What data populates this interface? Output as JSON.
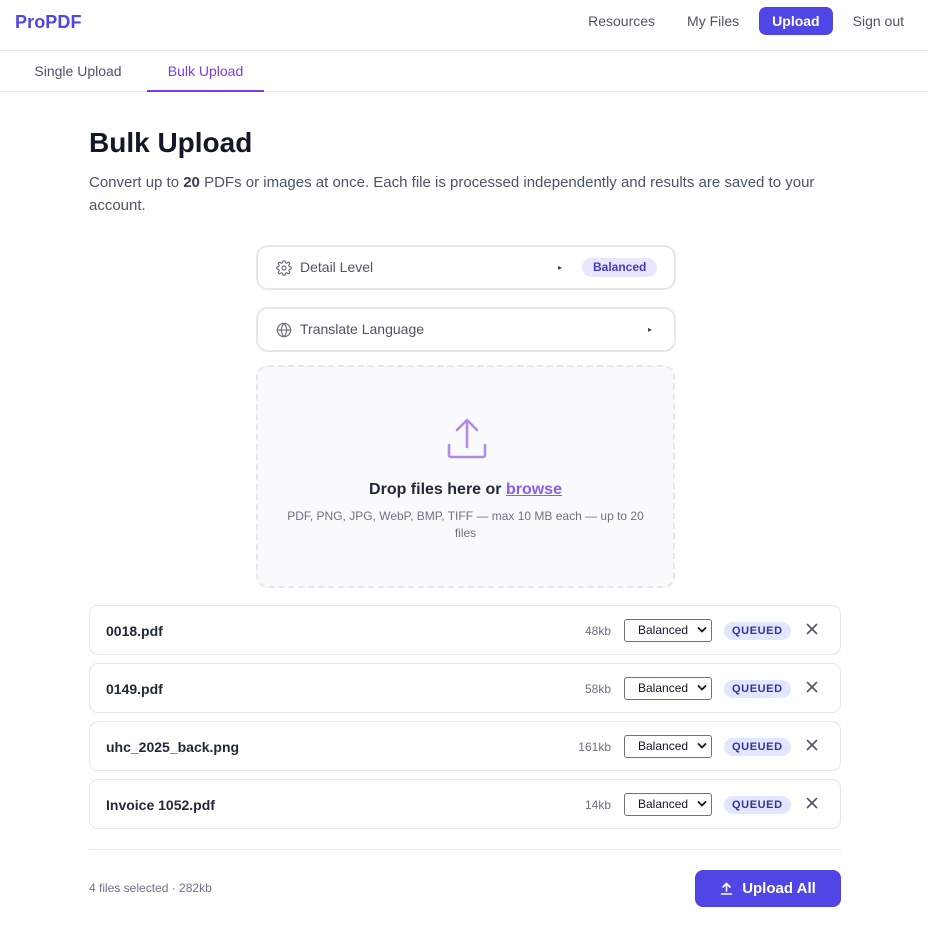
{
  "nav": {
    "brand": "ProPDF",
    "links": [
      {
        "label": "Resources"
      },
      {
        "label": "My Files"
      },
      {
        "label": "Upload"
      },
      {
        "label": "Sign out"
      }
    ]
  },
  "tabs": [
    {
      "label": "Single Upload"
    },
    {
      "label": "Bulk Upload"
    }
  ],
  "header": {
    "title": "Bulk Upload",
    "subtitle_before": "Convert up to ",
    "subtitle_count": "20",
    "subtitle_after": " PDFs or images at once. Each file is processed independently and results are saved to your account."
  },
  "options": {
    "detail_level": {
      "label": "Detail Level",
      "value": "Balanced",
      "icon": "gear-icon",
      "caret": "▸"
    },
    "translate_language": {
      "label": "Translate Language",
      "icon": "globe-icon",
      "caret": "▸"
    }
  },
  "dropzone": {
    "title_prefix": "Drop files here or ",
    "browse_label": "browse",
    "hint": "PDF, PNG, JPG, WebP, BMP, TIFF — max 10 MB each — up to 20 files",
    "icon": "upload-icon"
  },
  "files": [
    {
      "name": "0018.pdf",
      "size": "48kb",
      "detail": "Balanced",
      "status": "QUEUED"
    },
    {
      "name": "0149.pdf",
      "size": "58kb",
      "detail": "Balanced",
      "status": "QUEUED"
    },
    {
      "name": "uhc_2025_back.png",
      "size": "161kb",
      "detail": "Balanced",
      "status": "QUEUED"
    },
    {
      "name": "Invoice 1052.pdf",
      "size": "14kb",
      "detail": "Balanced",
      "status": "QUEUED"
    }
  ],
  "footer": {
    "summary": "4 files selected · 282kb",
    "upload_all_label": "Upload All"
  },
  "colors": {
    "accent": "#4f46e5",
    "accent_purple": "#7c3aed",
    "queued_badge_bg": "#e0e7ff"
  }
}
